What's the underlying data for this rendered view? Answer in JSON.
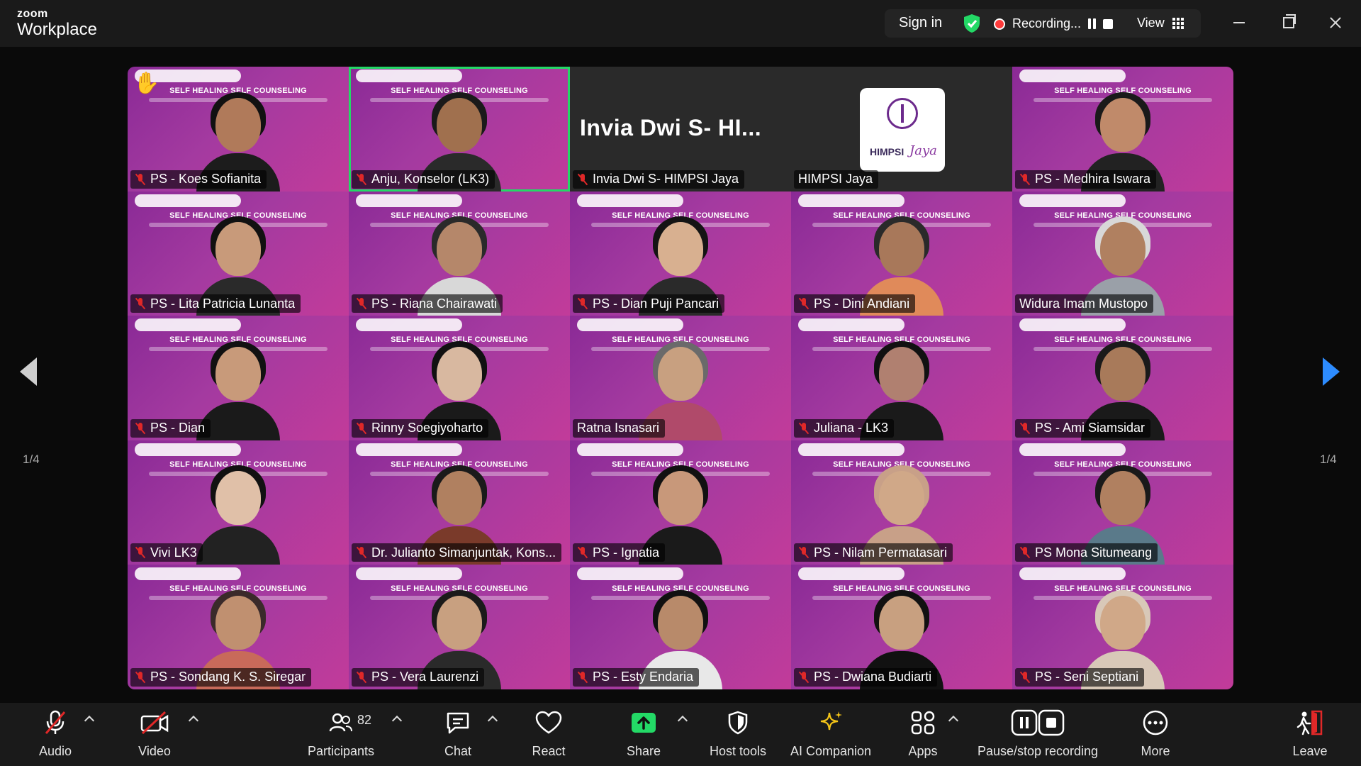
{
  "app": {
    "brand_top": "zoom",
    "brand_bottom": "Workplace"
  },
  "topbar": {
    "signin": "Sign in",
    "recording": "Recording...",
    "view": "View"
  },
  "pages": {
    "left": "1/4",
    "right": "1/4"
  },
  "tiles": [
    {
      "name": "PS - Koes Sofianita",
      "muted": true,
      "hand": true,
      "banner": "SELF HEALING SELF COUNSELING",
      "skin": "#b07a5a",
      "shirt": "#1c1c1c",
      "hair": "#111"
    },
    {
      "name": "Anju, Konselor (LK3)",
      "muted": true,
      "active": true,
      "banner": "SELF HEALING SELF COUNSELING",
      "skin": "#a0704e",
      "shirt": "#2a2a2a",
      "hair": "#1a1a1a"
    },
    {
      "name": "Invia Dwi S- HIMPSI Jaya",
      "muted": true,
      "dark": true,
      "big_name": "Invia Dwi S- HI..."
    },
    {
      "name": "HIMPSI Jaya",
      "muted": false,
      "dark": true,
      "logo": true,
      "logo_text": "HIMPSI",
      "logo_script": "Jaya"
    },
    {
      "name": "PS - Medhira Iswara",
      "muted": true,
      "banner": "SELF HEALING SELF COUNSELING",
      "skin": "#c08a6a",
      "shirt": "#222",
      "hair": "#1a1a1a"
    },
    {
      "name": "PS - Lita Patricia Lunanta",
      "muted": true,
      "banner": "SELF HEALING SELF COUNSELING",
      "skin": "#c89a7a",
      "shirt": "#2a2a2a",
      "hair": "#111"
    },
    {
      "name": "PS - Riana Chairawati",
      "muted": true,
      "banner": "SELF HEALING SELF COUNSELING",
      "skin": "#b5876a",
      "shirt": "#d8d8d8",
      "hair": "#2a2a2a"
    },
    {
      "name": "PS - Dian Puji Pancari",
      "muted": true,
      "banner": "SELF HEALING SELF COUNSELING",
      "skin": "#d8b090",
      "shirt": "#2a2a2a",
      "hair": "#141414"
    },
    {
      "name": "PS - Dini Andiani",
      "muted": true,
      "banner": "SELF HEALING SELF COUNSELING",
      "skin": "#a8785a",
      "shirt": "#e08a5a",
      "hair": "#2a2a2a"
    },
    {
      "name": "Widura Imam Mustopo",
      "muted": false,
      "banner": "SELF HEALING SELF COUNSELING",
      "skin": "#b08060",
      "shirt": "#9aa0a8",
      "hair": "#d8d8d8"
    },
    {
      "name": "PS - Dian",
      "muted": true,
      "banner": "SELF HEALING SELF COUNSELING",
      "skin": "#c89a7a",
      "shirt": "#1a1a1a",
      "hair": "#111"
    },
    {
      "name": "Rinny Soegiyoharto",
      "muted": true,
      "banner": "SELF HEALING SELF COUNSELING",
      "skin": "#d8b8a0",
      "shirt": "#1a1a1a",
      "hair": "#111"
    },
    {
      "name": "Ratna Isnasari",
      "muted": false,
      "banner": "SELF HEALING SELF COUNSELING",
      "skin": "#c8a080",
      "shirt": "#b04a6a",
      "hair": "#6a6a6a"
    },
    {
      "name": "Juliana - LK3",
      "muted": true,
      "banner": "SELF HEALING SELF COUNSELING",
      "skin": "#b08070",
      "shirt": "#1a1a1a",
      "hair": "#111"
    },
    {
      "name": "PS - Ami Siamsidar",
      "muted": true,
      "banner": "SELF HEALING SELF COUNSELING",
      "skin": "#a87a5a",
      "shirt": "#1a1a1a",
      "hair": "#1a1a1a"
    },
    {
      "name": "Vivi LK3",
      "muted": true,
      "banner": "SELF HEALING SELF COUNSELING",
      "skin": "#e0c0a8",
      "shirt": "#222",
      "hair": "#111"
    },
    {
      "name": "Dr. Julianto Simanjuntak, Kons...",
      "muted": true,
      "banner": "SELF HEALING SELF COUNSELING",
      "skin": "#b08060",
      "shirt": "#7a3a2a",
      "hair": "#1a1a1a"
    },
    {
      "name": "PS - Ignatia",
      "muted": true,
      "banner": "SELF HEALING SELF COUNSELING",
      "skin": "#c8987a",
      "shirt": "#1a1a1a",
      "hair": "#111"
    },
    {
      "name": "PS - Nilam Permatasari",
      "muted": true,
      "banner": "SELF HEALING SELF COUNSELING",
      "skin": "#d0a888",
      "shirt": "#c8a088",
      "hair": "#c8a088"
    },
    {
      "name": "PS Mona Situmeang",
      "muted": true,
      "banner": "SELF HEALING SELF COUNSELING",
      "skin": "#b08060",
      "shirt": "#5a7a8a",
      "hair": "#1a1a1a"
    },
    {
      "name": "PS - Sondang K. S. Siregar",
      "muted": true,
      "banner": "SELF HEALING SELF COUNSELING",
      "skin": "#c09070",
      "shirt": "#c86a5a",
      "hair": "#3a2a2a"
    },
    {
      "name": "PS - Vera Laurenzi",
      "muted": true,
      "banner": "SELF HEALING SELF COUNSELING",
      "skin": "#c8a080",
      "shirt": "#2a2a2a",
      "hair": "#1a1a1a"
    },
    {
      "name": "PS - Esty Endaria",
      "muted": true,
      "banner": "SELF HEALING SELF COUNSELING",
      "skin": "#b88a6a",
      "shirt": "#e8e8e8",
      "hair": "#111"
    },
    {
      "name": "PS - Dwiana Budiarti",
      "muted": true,
      "banner": "SELF HEALING SELF COUNSELING",
      "skin": "#c8a080",
      "shirt": "#111",
      "hair": "#111"
    },
    {
      "name": "PS - Seni Septiani",
      "muted": true,
      "banner": "SELF HEALING SELF COUNSELING",
      "skin": "#d0a888",
      "shirt": "#d8c8b8",
      "hair": "#d8c8b8"
    }
  ],
  "toolbar": {
    "audio": "Audio",
    "video": "Video",
    "participants": "Participants",
    "participants_count": "82",
    "chat": "Chat",
    "react": "React",
    "share": "Share",
    "host_tools": "Host tools",
    "ai_companion": "AI Companion",
    "apps": "Apps",
    "pause_stop": "Pause/stop recording",
    "more": "More",
    "leave": "Leave"
  },
  "colors": {
    "share_green": "#23d966",
    "mute_red": "#e02828",
    "active_outline": "#23d966",
    "nav_blue": "#2d8cff",
    "leave_red": "#e02828",
    "ai_gold": "#f5c518"
  }
}
